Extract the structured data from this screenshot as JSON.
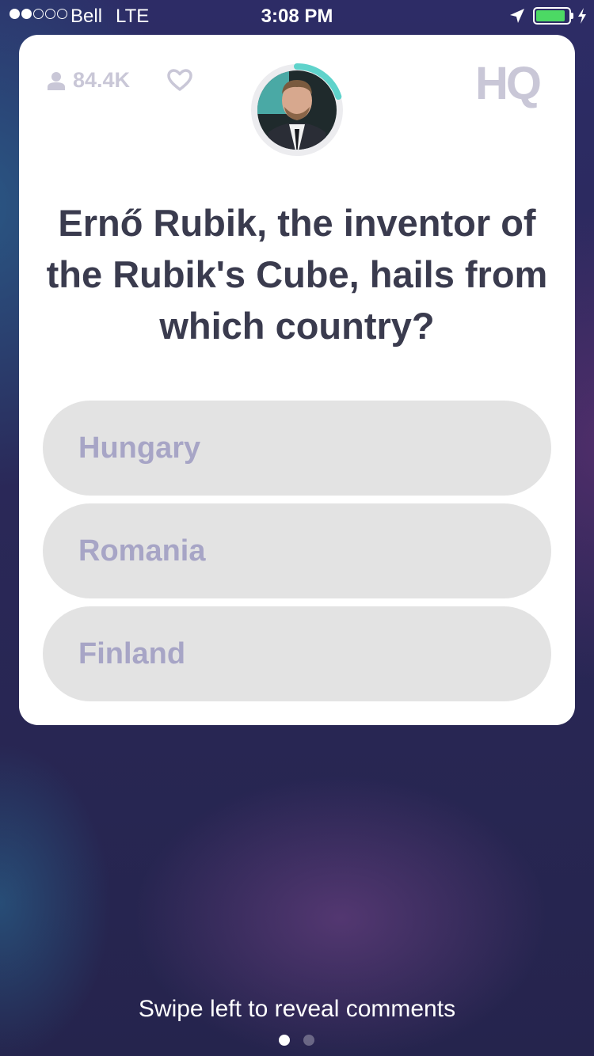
{
  "status_bar": {
    "carrier": "Bell",
    "network": "LTE",
    "time": "3:08 PM",
    "signal_bars_filled": 2,
    "signal_bars_total": 5,
    "battery_level": 0.9,
    "battery_color": "#4cd964",
    "icons": [
      "location-arrow-icon",
      "battery-icon",
      "charging-bolt-icon"
    ]
  },
  "header": {
    "viewer_count": "84.4K",
    "viewer_icon": "person-icon",
    "like_icon": "heart-outline-icon",
    "logo": "HQ",
    "timer_progress": 0.2,
    "timer_color": "#5fd3cb"
  },
  "question": {
    "text": "Ernő Rubik, the inventor of the Rubik's Cube, hails from which country?"
  },
  "answers": [
    {
      "label": "Hungary"
    },
    {
      "label": "Romania"
    },
    {
      "label": "Finland"
    }
  ],
  "footer": {
    "hint": "Swipe left to reveal comments",
    "page_count": 2,
    "active_page": 1
  },
  "colors": {
    "question_text": "#3a3b4e",
    "answer_background": "#e3e3e3",
    "answer_text": "#a7a5c6",
    "muted_icon": "#c9c7d7"
  }
}
